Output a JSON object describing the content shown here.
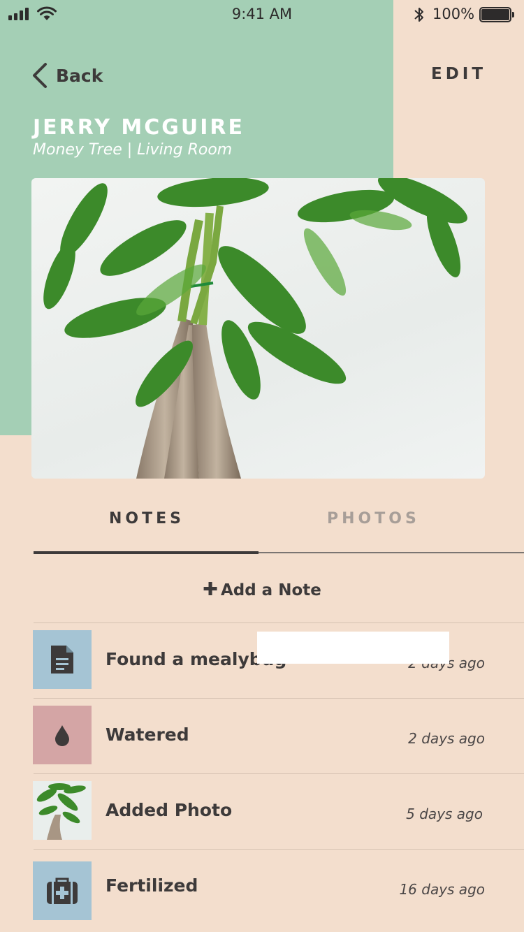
{
  "status_bar": {
    "time": "9:41 AM",
    "battery_percent": "100%",
    "battery_level": 1.0,
    "icons": [
      "signal-icon",
      "wifi-icon",
      "bluetooth-icon",
      "battery-icon"
    ]
  },
  "nav": {
    "back_label": "Back",
    "edit_label": "EDIT"
  },
  "plant": {
    "name": "JERRY MCGUIRE",
    "subtitle": "Money Tree | Living Room"
  },
  "tabs": [
    {
      "label": "NOTES",
      "active": true
    },
    {
      "label": "PHOTOS",
      "active": false
    }
  ],
  "add_note": {
    "icon": "plus-icon",
    "label": "Add a Note"
  },
  "notes": [
    {
      "title": "Found a mealybug",
      "when": "2 days ago",
      "icon": "document-icon",
      "color": "#a5c4d4"
    },
    {
      "title": "Watered",
      "when": "2 days ago",
      "icon": "water-drop-icon",
      "color": "#d4a5a5"
    },
    {
      "title": "Added Photo",
      "when": "5 days ago",
      "icon": "photo-thumbnail",
      "color": "#e9eeec"
    },
    {
      "title": "Fertilized",
      "when": "16 days ago",
      "icon": "first-aid-kit-icon",
      "color": "#a5c4d4"
    }
  ],
  "colors": {
    "header_green": "#a4cfb5",
    "background": "#f3decd",
    "text_dark": "#3d3a3a",
    "tab_inactive": "#a79e98"
  }
}
